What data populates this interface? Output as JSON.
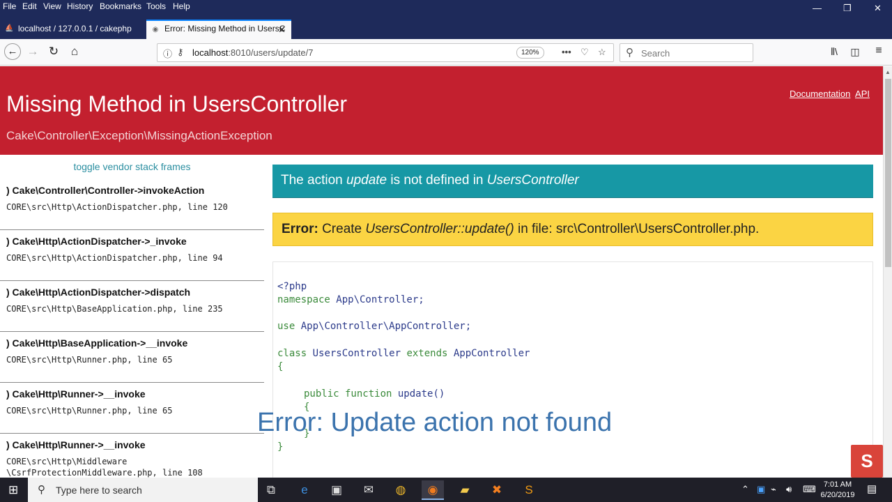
{
  "menubar": {
    "items": [
      "File",
      "Edit",
      "View",
      "History",
      "Bookmarks",
      "Tools",
      "Help"
    ],
    "minimize": "—",
    "restore": "❐",
    "close": "✕"
  },
  "tabs": [
    {
      "title": "localhost / 127.0.0.1 / cakephp",
      "icon": "phpmyadmin-icon",
      "close": "✕"
    },
    {
      "title": "Error: Missing Method in UsersC",
      "icon": "page-icon",
      "close": "✕"
    }
  ],
  "new_tab": "+",
  "navbar": {
    "url_host": "localhost",
    "url_path": ":8010/users/update/7",
    "zoom": "120%",
    "search_placeholder": "Search"
  },
  "error_page": {
    "title": "Missing Method in UsersController",
    "exception": "Cake\\Controller\\Exception\\MissingActionException",
    "links": [
      "Documentation",
      "API"
    ],
    "toggle_vendor": "toggle vendor stack frames",
    "frames": [
      {
        "fn": ") Cake\\Controller\\Controller->invokeAction",
        "file": "CORE\\src\\Http\\ActionDispatcher.php, line 120"
      },
      {
        "fn": ") Cake\\Http\\ActionDispatcher->_invoke",
        "file": "CORE\\src\\Http\\ActionDispatcher.php, line 94"
      },
      {
        "fn": ") Cake\\Http\\ActionDispatcher->dispatch",
        "file": "CORE\\src\\Http\\BaseApplication.php, line 235"
      },
      {
        "fn": ") Cake\\Http\\BaseApplication->__invoke",
        "file": "CORE\\src\\Http\\Runner.php, line 65"
      },
      {
        "fn": ") Cake\\Http\\Runner->__invoke",
        "file": "CORE\\src\\Http\\Runner.php, line 65"
      },
      {
        "fn": ") Cake\\Http\\Runner->__invoke",
        "file": "CORE\\src\\Http\\Middleware\n\\CsrfProtectionMiddleware.php, line 108"
      }
    ],
    "action_msg": {
      "prefix": "The action ",
      "action": "update",
      "middle": " is not defined in ",
      "controller": "UsersController"
    },
    "error_msg": {
      "label": "Error:",
      "prefix": " Create ",
      "method": "UsersController::update()",
      "suffix": " in file: src\\Controller\\UsersController.php."
    },
    "code": {
      "l1": "<?php",
      "l2_kw": "namespace",
      "l2_name": " App\\Controller;",
      "l3_kw": "use",
      "l3_name": " App\\Controller\\AppController;",
      "l4_kw1": "class",
      "l4_name1": " UsersController ",
      "l4_kw2": "extends",
      "l4_name2": " AppController",
      "l5": "{",
      "l6_kw": "public function",
      "l6_name": " update()",
      "l7": "{",
      "l8": "}",
      "l9": "}"
    }
  },
  "overlay_caption": "Error: Update action not found",
  "taskbar": {
    "search_placeholder": "Type here to search",
    "time": "7:01 AM",
    "date": "6/20/2019"
  }
}
